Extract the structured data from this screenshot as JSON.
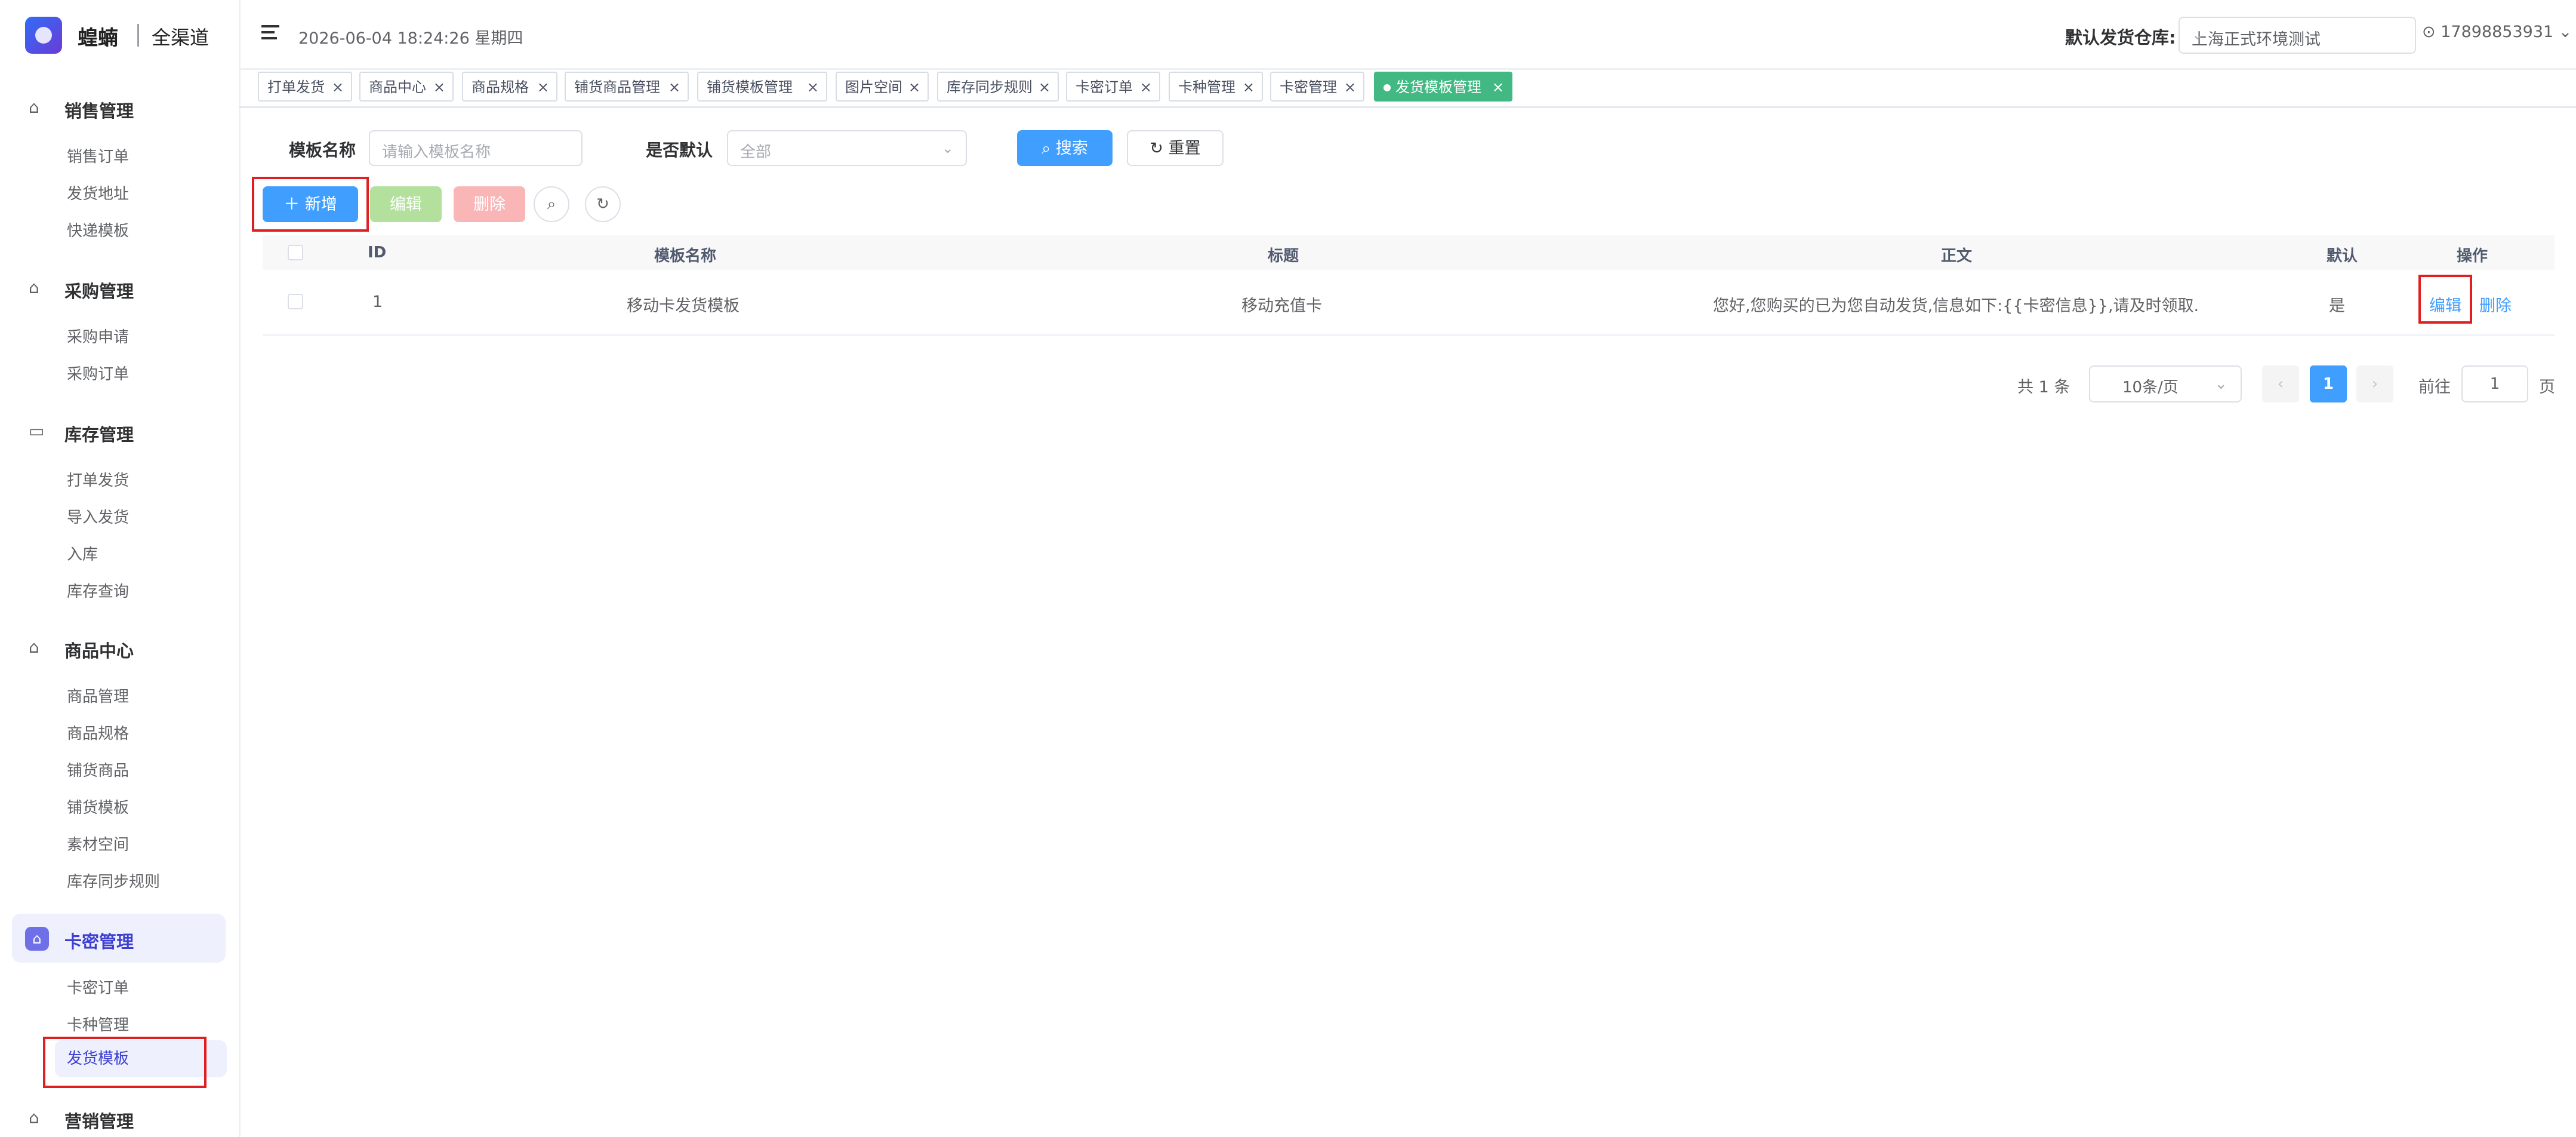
{
  "brand": {
    "name": "蝗蝻",
    "sub": "全渠道"
  },
  "header": {
    "datetime": "2026-06-04 18:24:26 星期四",
    "warehouse_label": "默认发货仓库:",
    "warehouse_value": "上海正式环境测试",
    "user": "17898853931"
  },
  "sidebar": {
    "groups": [
      {
        "label": "销售管理",
        "items": [
          "销售订单",
          "发货地址",
          "快递模板"
        ]
      },
      {
        "label": "采购管理",
        "items": [
          "采购申请",
          "采购订单"
        ]
      },
      {
        "label": "库存管理",
        "items": [
          "打单发货",
          "导入发货",
          "入库",
          "库存查询"
        ]
      },
      {
        "label": "商品中心",
        "items": [
          "商品管理",
          "商品规格",
          "铺货商品",
          "铺货模板",
          "素材空间",
          "库存同步规则"
        ]
      },
      {
        "label": "卡密管理",
        "items": [
          "卡密订单",
          "卡种管理",
          "发货模板"
        ]
      },
      {
        "label": "营销管理",
        "items": []
      }
    ]
  },
  "tabs": [
    "打单发货",
    "商品中心",
    "商品规格",
    "铺货商品管理",
    "铺货模板管理",
    "图片空间",
    "库存同步规则",
    "卡密订单",
    "卡种管理",
    "卡密管理",
    "发货模板管理"
  ],
  "search": {
    "name_label": "模板名称",
    "name_placeholder": "请输入模板名称",
    "default_label": "是否默认",
    "default_value": "全部",
    "search_btn": "搜索",
    "reset_btn": "重置"
  },
  "toolbar": {
    "add": "新增",
    "edit": "编辑",
    "delete": "删除"
  },
  "table": {
    "headers": [
      "ID",
      "模板名称",
      "标题",
      "正文",
      "默认",
      "操作"
    ],
    "rows": [
      {
        "id": "1",
        "name": "移动卡发货模板",
        "title": "移动充值卡",
        "body": "您好,您购买的已为您自动发货,信息如下:{{卡密信息}},请及时领取.",
        "default": "是",
        "edit": "编辑",
        "delete": "删除"
      }
    ]
  },
  "pagination": {
    "total": "共 1 条",
    "page_size": "10条/页",
    "current": "1",
    "goto_label": "前往",
    "goto_value": "1",
    "page_suffix": "页"
  }
}
